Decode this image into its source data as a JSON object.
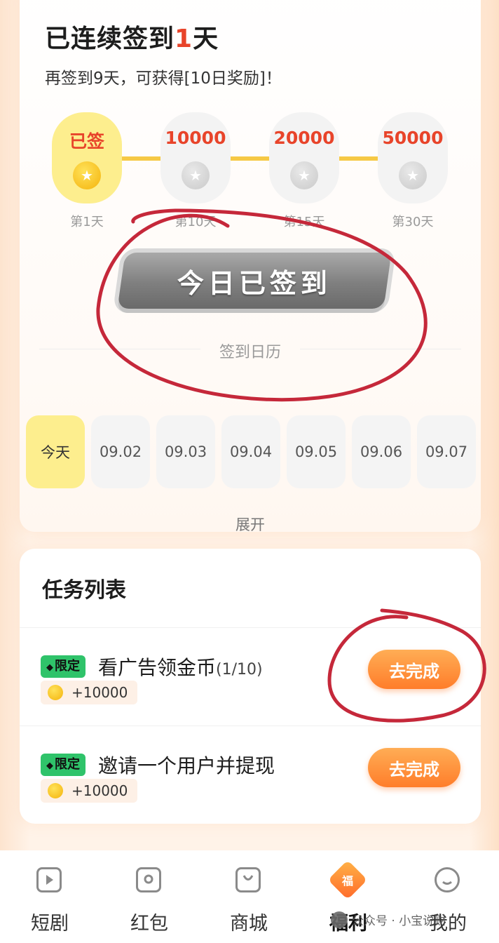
{
  "signin": {
    "title_prefix": "已连续",
    "title_highlight": "签到",
    "title_num": "1",
    "title_suffix": "天",
    "subtitle": "再签到9天，可获得[10日奖励]！",
    "milestones": [
      {
        "value": "已签",
        "day": "第1天",
        "done": true
      },
      {
        "value": "10000",
        "day": "第10天",
        "done": false
      },
      {
        "value": "20000",
        "day": "第15天",
        "done": false
      },
      {
        "value": "50000",
        "day": "第30天",
        "done": false
      }
    ],
    "checkin_button": "今日已签到",
    "calendar_title": "签到日历",
    "calendar": [
      "今天",
      "09.02",
      "09.03",
      "09.04",
      "09.05",
      "09.06",
      "09.07"
    ],
    "expand": "展开"
  },
  "tasks": {
    "title_plain": "任务",
    "title_highlight": "列表",
    "items": [
      {
        "badge": "限定",
        "name": "看广告领金币",
        "progress": "(1/10)",
        "reward": "+10000",
        "button": "去完成"
      },
      {
        "badge": "限定",
        "name": "邀请一个用户并提现",
        "progress": "",
        "reward": "+10000",
        "button": "去完成"
      }
    ]
  },
  "tabbar": {
    "items": [
      {
        "label": "短剧",
        "icon": "play-icon"
      },
      {
        "label": "红包",
        "icon": "red-packet-icon"
      },
      {
        "label": "商城",
        "icon": "shopping-bag-icon"
      },
      {
        "label": "福利",
        "icon": "fu-icon",
        "active": true,
        "icon_text": "福"
      },
      {
        "label": "我的",
        "icon": "profile-icon"
      }
    ]
  },
  "watermark": "公众号 · 小宝说财",
  "colors": {
    "accent": "#ff7d2a",
    "highlight_red": "#e8442a",
    "streak_yellow": "#fdee8e",
    "annotation_red": "#c5283a"
  }
}
